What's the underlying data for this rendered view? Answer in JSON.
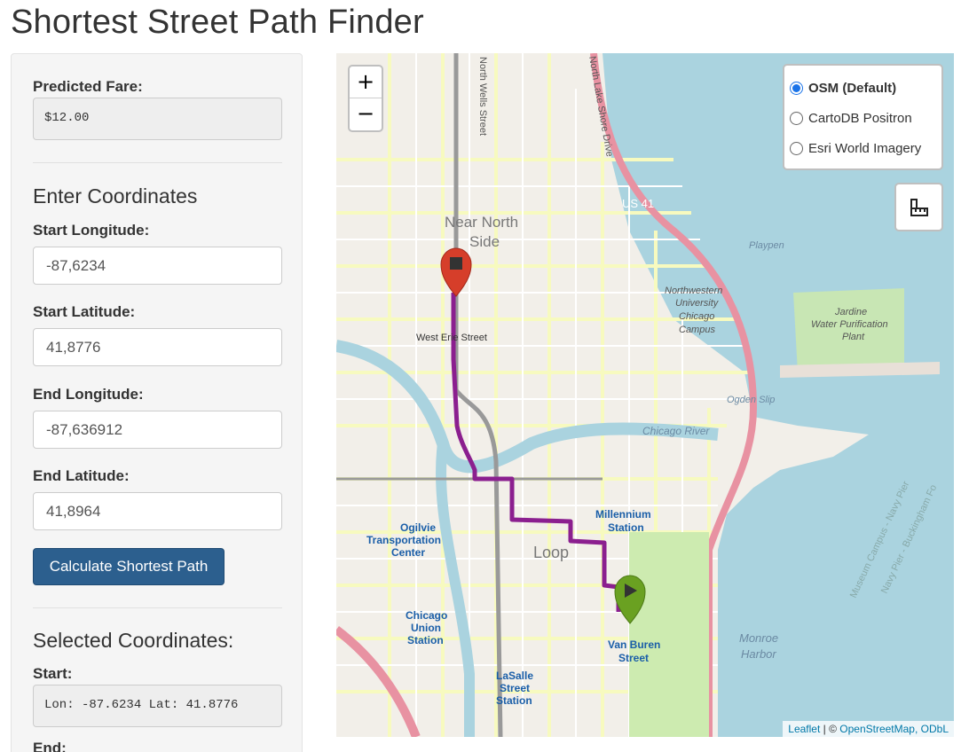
{
  "page": {
    "title": "Shortest Street Path Finder"
  },
  "sidebar": {
    "fare_label": "Predicted Fare:",
    "fare_value": "$12.00",
    "coords_heading": "Enter Coordinates",
    "start_lon_label": "Start Longitude:",
    "start_lon_value": "-87,6234",
    "start_lat_label": "Start Latitude:",
    "start_lat_value": "41,8776",
    "end_lon_label": "End Longitude:",
    "end_lon_value": "-87,636912",
    "end_lat_label": "End Latitude:",
    "end_lat_value": "41,8964",
    "calc_button": "Calculate Shortest Path",
    "selected_heading": "Selected Coordinates:",
    "start_label": "Start:",
    "start_readout": "Lon: -87.6234 Lat: 41.8776",
    "end_label": "End:"
  },
  "map": {
    "zoom_in": "+",
    "zoom_out": "−",
    "layers": [
      {
        "label": "OSM (Default)",
        "selected": true
      },
      {
        "label": "CartoDB Positron",
        "selected": false
      },
      {
        "label": "Esri World Imagery",
        "selected": false
      }
    ],
    "measure_icon": "ruler-icon",
    "route_color": "#8b1f8f",
    "start_marker_color": "#6aa121",
    "end_marker_color": "#d63e2a",
    "labels": {
      "near_north": "Near North",
      "side": "Side",
      "loop": "Loop",
      "us41": "US 41",
      "west_erie": "West Erie Street",
      "nw1": "Northwestern",
      "nw2": "University",
      "nw3": "Chicago",
      "nw4": "Campus",
      "jardine1": "Jardine",
      "jardine2": "Water Purification",
      "jardine3": "Plant",
      "chicago_river": "Chicago River",
      "ogden_slip": "Ogden Slip",
      "playpen": "Playpen",
      "millennium1": "Millennium",
      "millennium2": "Station",
      "ogilvie1": "Ogilvie",
      "ogilvie2": "Transportation",
      "ogilvie3": "Center",
      "union1": "Chicago",
      "union2": "Union",
      "union3": "Station",
      "vanburen1": "Van Buren",
      "vanburen2": "Street",
      "lasalle1": "LaSalle",
      "lasalle2": "Street",
      "lasalle3": "Station",
      "monroe1": "Monroe",
      "monroe2": "Harbor",
      "wells": "North Wells Street",
      "lakeshore": "North Lake Shore Drive",
      "museum": "Museum Campus - Navy Pier",
      "navypier": "Navy Pier - Buckingham Fo"
    },
    "attribution": {
      "leaflet": "Leaflet",
      "sep": " | © ",
      "osm": "OpenStreetMap",
      "odbl": ", ODbL"
    }
  }
}
